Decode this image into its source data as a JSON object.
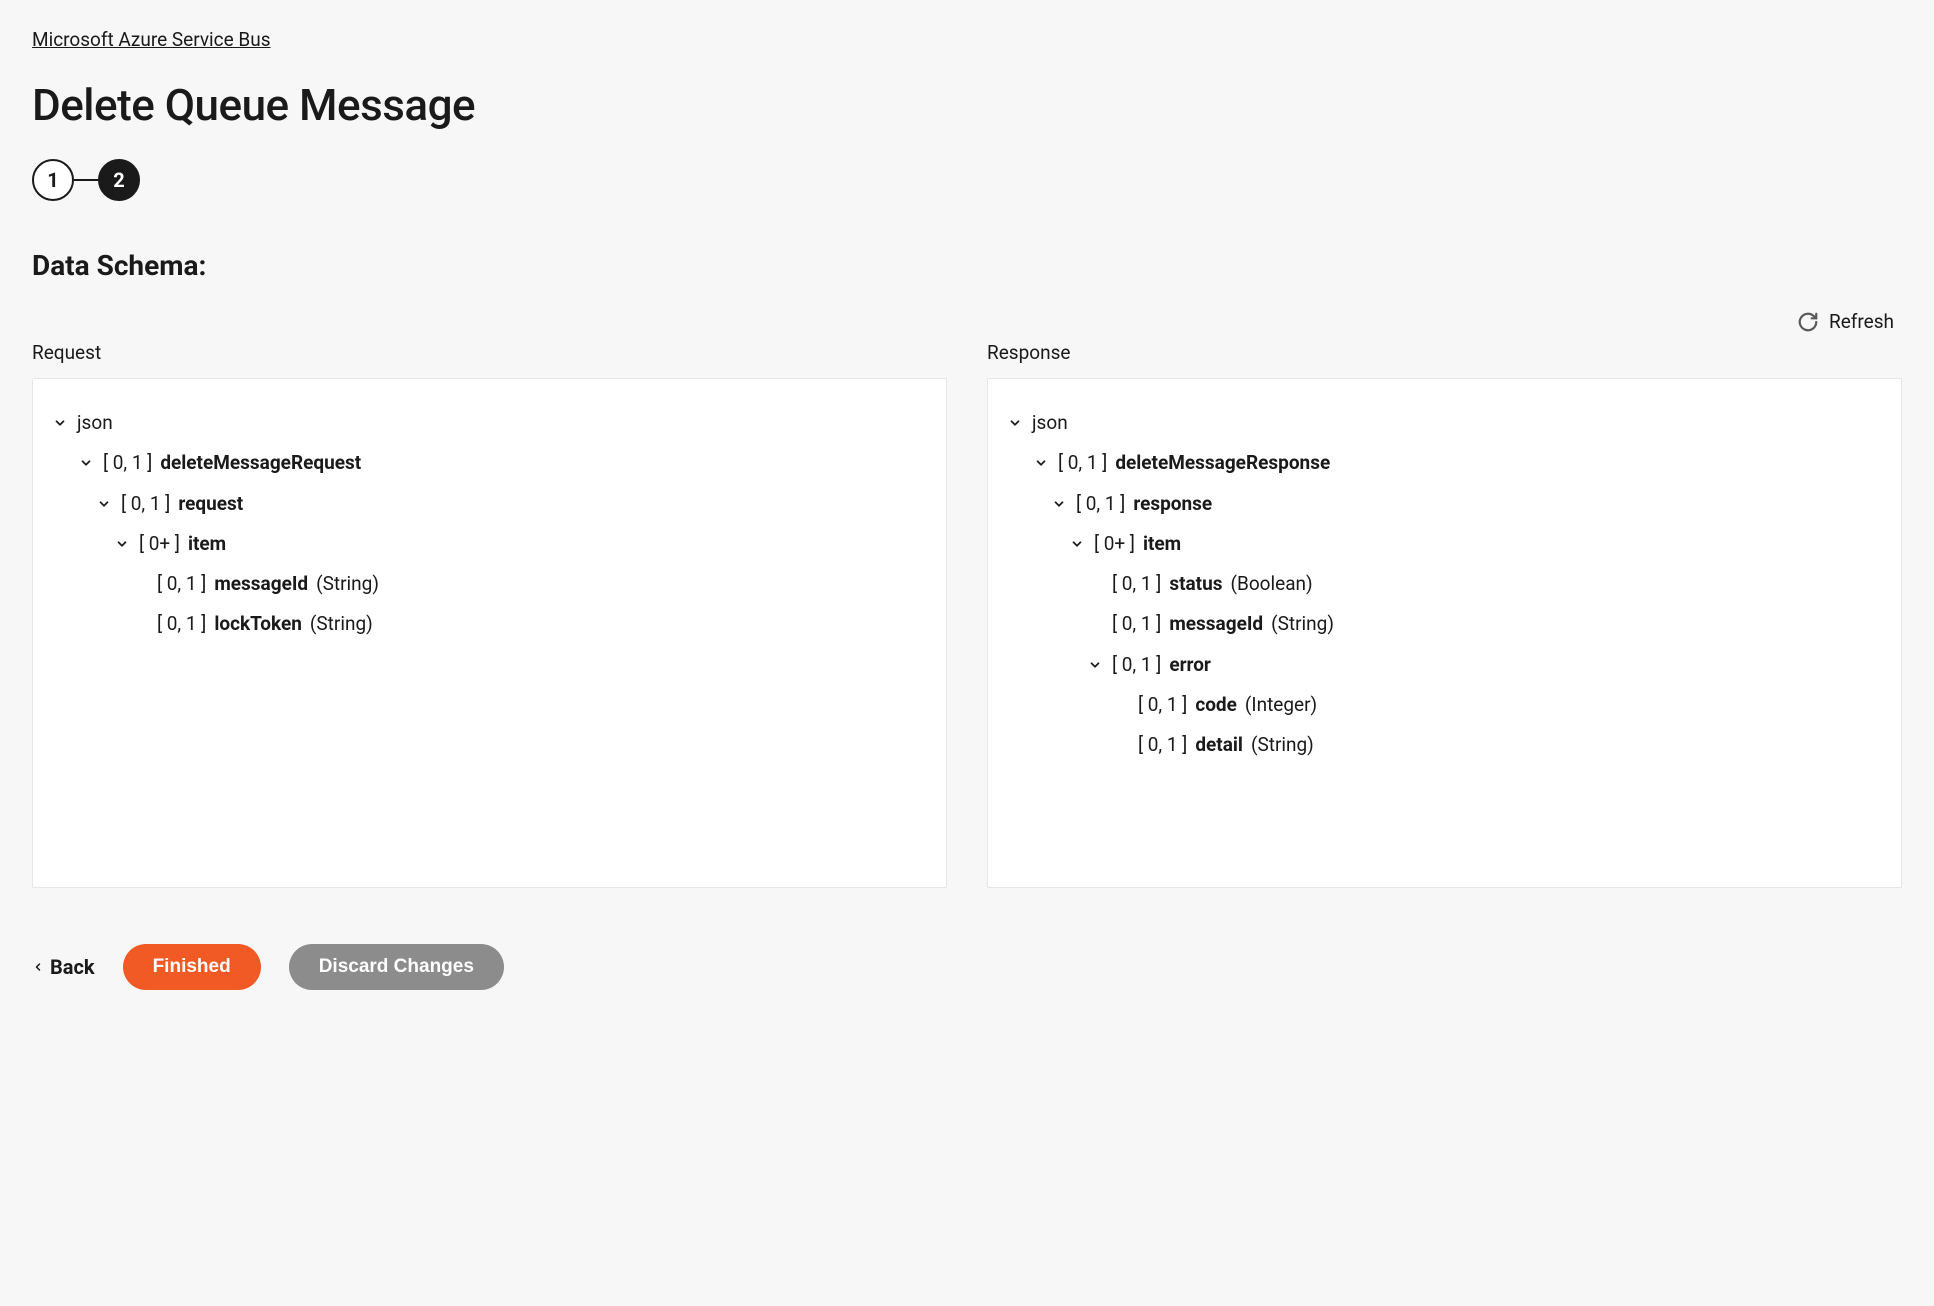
{
  "breadcrumb": "Microsoft Azure Service Bus",
  "page_title": "Delete Queue Message",
  "stepper": {
    "step1": "1",
    "step2": "2"
  },
  "section_title": "Data Schema:",
  "refresh_label": "Refresh",
  "columns": {
    "request_label": "Request",
    "response_label": "Response"
  },
  "request_tree": {
    "root": "json",
    "n1": {
      "card": "[ 0, 1 ]",
      "name": "deleteMessageRequest"
    },
    "n2": {
      "card": "[ 0, 1 ]",
      "name": "request"
    },
    "n3": {
      "card": "[ 0+ ]",
      "name": "item"
    },
    "n4": {
      "card": "[ 0, 1 ]",
      "name": "messageId",
      "type": "(String)"
    },
    "n5": {
      "card": "[ 0, 1 ]",
      "name": "lockToken",
      "type": "(String)"
    }
  },
  "response_tree": {
    "root": "json",
    "n1": {
      "card": "[ 0, 1 ]",
      "name": "deleteMessageResponse"
    },
    "n2": {
      "card": "[ 0, 1 ]",
      "name": "response"
    },
    "n3": {
      "card": "[ 0+ ]",
      "name": "item"
    },
    "n4": {
      "card": "[ 0, 1 ]",
      "name": "status",
      "type": "(Boolean)"
    },
    "n5": {
      "card": "[ 0, 1 ]",
      "name": "messageId",
      "type": "(String)"
    },
    "n6": {
      "card": "[ 0, 1 ]",
      "name": "error"
    },
    "n7": {
      "card": "[ 0, 1 ]",
      "name": "code",
      "type": "(Integer)"
    },
    "n8": {
      "card": "[ 0, 1 ]",
      "name": "detail",
      "type": "(String)"
    }
  },
  "footer": {
    "back": "Back",
    "finished": "Finished",
    "discard": "Discard Changes"
  }
}
